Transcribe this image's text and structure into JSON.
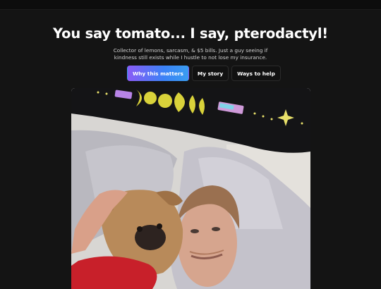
{
  "header": {
    "title": "You say tomato... I say, pterodactyl!",
    "subtitle": "Collector of lemons, sarcasm, & $5 bills. Just a guy seeing if kindness still exists while I hustle to not lose my insurance."
  },
  "tabs": [
    {
      "label": "Why this matters",
      "active": true
    },
    {
      "label": "My story",
      "active": false
    },
    {
      "label": "Ways to help",
      "active": false
    }
  ],
  "photo": {
    "subject": "selfie-man-with-pug"
  },
  "colors": {
    "background": "#141414",
    "accent_gradient_start": "#8a5cf6",
    "accent_gradient_end": "#3a9cf0"
  }
}
